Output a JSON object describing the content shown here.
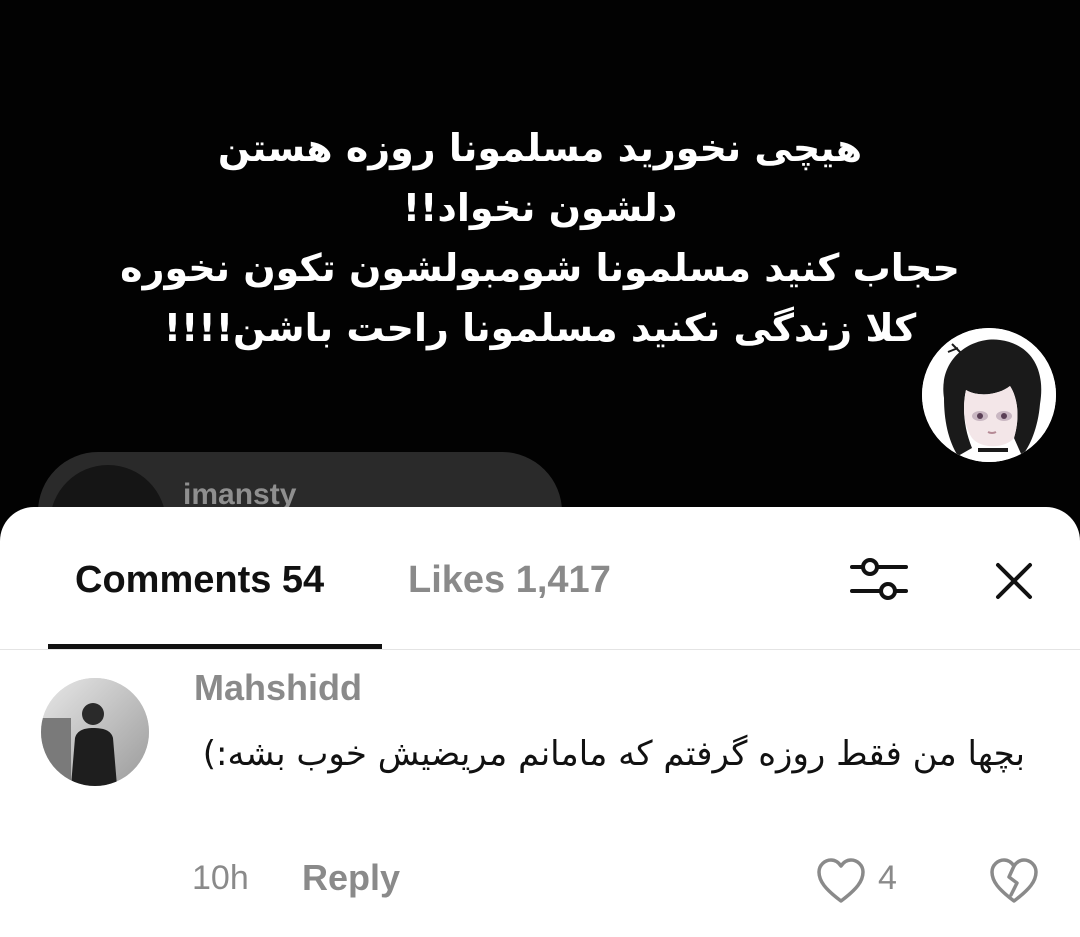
{
  "video": {
    "overlay_lines": [
      "هیچی نخورید مسلمونا روزه هستن",
      "دلشون نخواد!!",
      "حجاب کنید مسلمونا شومبولشون تکون نخوره",
      "کلا زندگی نکنید مسلمونا راحت باشن!!!!"
    ],
    "reposted_username": "imansty"
  },
  "sheet": {
    "tabs": {
      "comments_label": "Comments 54",
      "likes_label": "Likes 1,417"
    },
    "icons": {
      "filter": "filter-icon",
      "close": "close-icon"
    }
  },
  "comment": {
    "username": "Mahshidd",
    "text": "بچها من فقط روزه گرفتم که مامانم مریضیش خوب بشه:)",
    "time": "10h",
    "reply_label": "Reply",
    "like_count": "4",
    "icons": {
      "like": "heart-outline-icon",
      "dislike": "broken-heart-icon"
    }
  },
  "colors": {
    "accent_text": "#111111",
    "muted_text": "#8a8a8a",
    "sheet_bg": "#ffffff",
    "video_bg": "#000000"
  }
}
